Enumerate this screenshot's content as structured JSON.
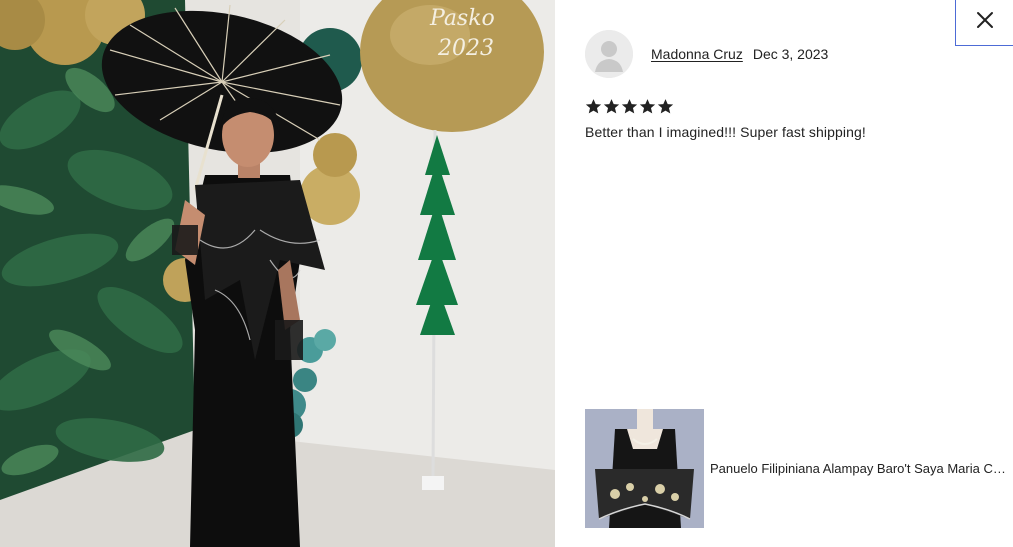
{
  "review": {
    "reviewer_name": "Madonna Cruz",
    "date": "Dec 3, 2023",
    "rating": 5,
    "rating_max": 5,
    "text": "Better than I imagined!!! Super fast shipping!"
  },
  "item": {
    "title": "Panuelo Filipiniana Alampay Baro't Saya Maria Clara Organza Shawl"
  },
  "photo": {
    "balloon_text_line1": "Pasko",
    "balloon_text_line2": "2023"
  },
  "icons": {
    "close": "close-icon",
    "star": "star-icon",
    "avatar": "user-avatar-icon"
  },
  "colors": {
    "focus_border": "#4d6bd6",
    "text": "#222222",
    "star": "#222222"
  }
}
